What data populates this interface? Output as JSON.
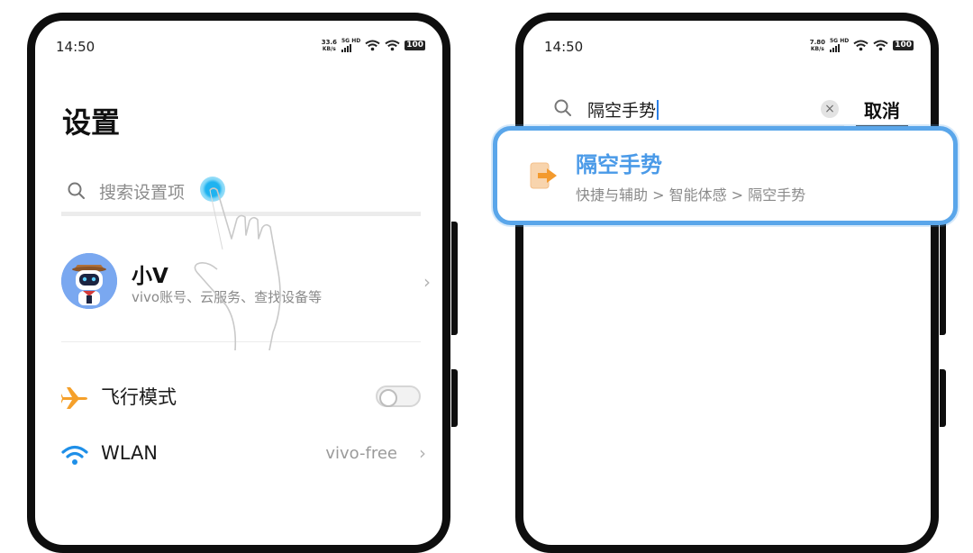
{
  "left_screen": {
    "status_bar": {
      "time": "14:50",
      "net_speed_value": "33.6",
      "net_speed_unit": "KB/s",
      "network_label": "5G HD",
      "battery": "100"
    },
    "title": "设置",
    "search": {
      "placeholder": "搜索设置项"
    },
    "profile": {
      "name": "小V",
      "subtitle": "vivo账号、云服务、查找设备等"
    },
    "items": [
      {
        "icon": "airplane-icon",
        "label": "飞行模式",
        "toggle_on": false
      },
      {
        "icon": "wifi-icon",
        "label": "WLAN",
        "value": "vivo-free"
      }
    ]
  },
  "right_screen": {
    "status_bar": {
      "time": "14:50",
      "net_speed_value": "7.80",
      "net_speed_unit": "KB/s",
      "network_label": "5G HD",
      "battery": "100"
    },
    "search": {
      "query": "隔空手势",
      "cancel_label": "取消"
    },
    "result": {
      "icon": "gesture-exit-icon",
      "title": "隔空手势",
      "path": "快捷与辅助 > 智能体感 > 隔空手势"
    }
  },
  "colors": {
    "accent_blue": "#4a9ae8",
    "highlight_border": "#5aa6ea",
    "airplane_orange": "#f5a02a",
    "wifi_blue": "#1e8fe8",
    "tap_cyan": "#1fb3f0"
  }
}
